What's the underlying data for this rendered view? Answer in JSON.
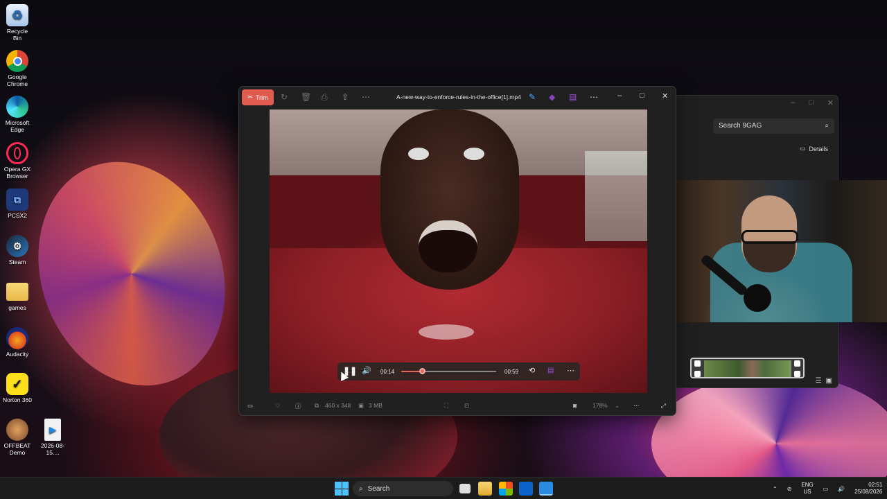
{
  "desktop": {
    "icons": [
      {
        "label": "Recycle Bin",
        "icon": "recycle-bin-icon"
      },
      {
        "label": "Google Chrome",
        "icon": "chrome-icon"
      },
      {
        "label": "Microsoft Edge",
        "icon": "edge-icon"
      },
      {
        "label": "Opera GX Browser",
        "icon": "opera-gx-icon"
      },
      {
        "label": "PCSX2",
        "icon": "pcsx2-icon"
      },
      {
        "label": "Steam",
        "icon": "steam-icon"
      },
      {
        "label": "games",
        "icon": "folder-icon"
      },
      {
        "label": "Audacity",
        "icon": "audacity-icon"
      },
      {
        "label": "Norton 360",
        "icon": "norton-icon"
      },
      {
        "label": "OFFBEAT Demo",
        "icon": "offbeat-icon"
      },
      {
        "label": "2026-08-15....",
        "icon": "video-file-icon"
      }
    ]
  },
  "player": {
    "trim_label": "Trim",
    "filename": "A-new-way-to-enforce-rules-in-the-office[1].mp4",
    "time_current": "00:14",
    "time_total": "00:59",
    "progress_fraction": 0.22,
    "dimensions": "460 x 348",
    "file_size": "3 MB",
    "zoom": "178%",
    "accent": "#e05c4e"
  },
  "background_window": {
    "search_placeholder": "Search 9GAG",
    "details_label": "Details"
  },
  "taskbar": {
    "search_label": "Search",
    "lang_top": "ENG",
    "lang_bottom": "US",
    "time": "02:51",
    "date": "25/08/2026"
  }
}
